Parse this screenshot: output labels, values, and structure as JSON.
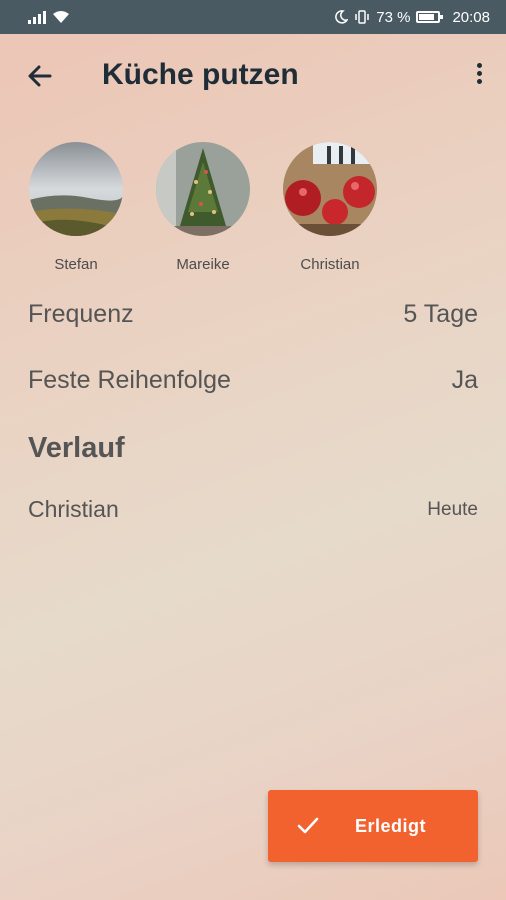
{
  "status_bar": {
    "battery_percent": "73 %",
    "time": "20:08"
  },
  "app_bar": {
    "title": "Küche putzen"
  },
  "members": [
    {
      "name": "Stefan"
    },
    {
      "name": "Mareike"
    },
    {
      "name": "Christian"
    }
  ],
  "details": {
    "frequency_label": "Frequenz",
    "frequency_value": "5 Tage",
    "fixed_order_label": "Feste Reihenfolge",
    "fixed_order_value": "Ja"
  },
  "history": {
    "title": "Verlauf",
    "entries": [
      {
        "name": "Christian",
        "when": "Heute"
      }
    ]
  },
  "fab": {
    "label": "Erledigt"
  },
  "colors": {
    "accent": "#f2622e",
    "status_bar": "#4a5a63",
    "title_text": "#1f2d36"
  }
}
